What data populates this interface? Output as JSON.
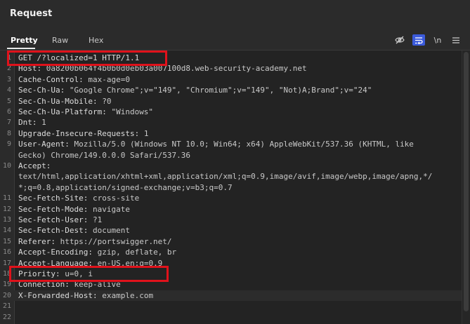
{
  "panel": {
    "title": "Request"
  },
  "tabs": [
    {
      "label": "Pretty"
    },
    {
      "label": "Raw"
    },
    {
      "label": "Hex"
    }
  ],
  "toolbar": {
    "hide_icon": "eye-slash-icon",
    "wrap_icon": "wrap-lines-icon",
    "newline_label": "\\n",
    "menu_icon": "hamburger-menu-icon"
  },
  "colors": {
    "highlight": "#e0121b",
    "active_tool": "#3b5bdb"
  },
  "lines": [
    {
      "n": "1",
      "key": "GET /?localized=1 HTTP/1.1",
      "val": ""
    },
    {
      "n": "2",
      "key": "Host: ",
      "val": "0a8200b064f4b0b0d0eb03a007100d8.web-security-academy.net"
    },
    {
      "n": "3",
      "key": "Cache-Control: ",
      "val": "max-age=0"
    },
    {
      "n": "4",
      "key": "Sec-Ch-Ua: ",
      "val": "\"Google Chrome\";v=\"149\", \"Chromium\";v=\"149\", \"Not)A;Brand\";v=\"24\""
    },
    {
      "n": "5",
      "key": "Sec-Ch-Ua-Mobile: ",
      "val": "?0"
    },
    {
      "n": "6",
      "key": "Sec-Ch-Ua-Platform: ",
      "val": "\"Windows\""
    },
    {
      "n": "7",
      "key": "Dnt: ",
      "val": "1"
    },
    {
      "n": "8",
      "key": "Upgrade-Insecure-Requests: ",
      "val": "1"
    },
    {
      "n": "9",
      "key": "User-Agent: ",
      "val": "Mozilla/5.0 (Windows NT 10.0; Win64; x64) AppleWebKit/537.36 (KHTML, like"
    },
    {
      "n": "",
      "key": "",
      "val": "Gecko) Chrome/149.0.0.0 Safari/537.36"
    },
    {
      "n": "10",
      "key": "Accept:",
      "val": ""
    },
    {
      "n": "",
      "key": "",
      "val": "text/html,application/xhtml+xml,application/xml;q=0.9,image/avif,image/webp,image/apng,*/"
    },
    {
      "n": "",
      "key": "",
      "val": "*;q=0.8,application/signed-exchange;v=b3;q=0.7"
    },
    {
      "n": "11",
      "key": "Sec-Fetch-Site: ",
      "val": "cross-site"
    },
    {
      "n": "12",
      "key": "Sec-Fetch-Mode: ",
      "val": "navigate"
    },
    {
      "n": "13",
      "key": "Sec-Fetch-User: ",
      "val": "?1"
    },
    {
      "n": "14",
      "key": "Sec-Fetch-Dest: ",
      "val": "document"
    },
    {
      "n": "15",
      "key": "Referer: ",
      "val": "https://portswigger.net/"
    },
    {
      "n": "16",
      "key": "Accept-Encoding: ",
      "val": "gzip, deflate, br"
    },
    {
      "n": "17",
      "key": "Accept-Language: ",
      "val": "en-US,en;q=0.9"
    },
    {
      "n": "18",
      "key": "Priority: ",
      "val": "u=0, i"
    },
    {
      "n": "19",
      "key": "Connection: ",
      "val": "keep-alive"
    },
    {
      "n": "20",
      "key": "X-Forwarded-Host: ",
      "val": "example.com"
    },
    {
      "n": "21",
      "key": "",
      "val": ""
    },
    {
      "n": "22",
      "key": "",
      "val": ""
    }
  ]
}
